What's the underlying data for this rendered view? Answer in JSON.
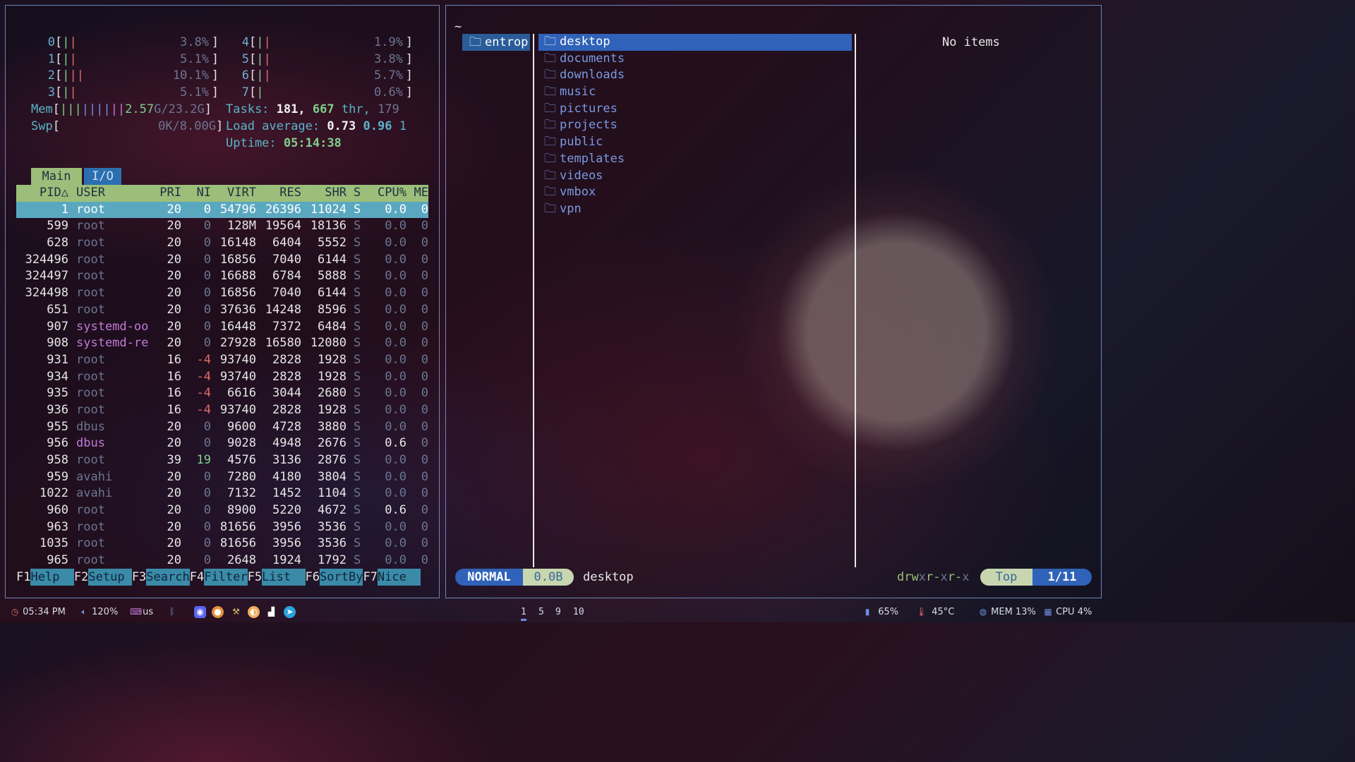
{
  "htop": {
    "cpus": [
      {
        "id": "0",
        "bars": "||",
        "pct": "3.8%"
      },
      {
        "id": "1",
        "bars": "||",
        "pct": "5.1%"
      },
      {
        "id": "2",
        "bars": "|||",
        "pct": "10.1%"
      },
      {
        "id": "3",
        "bars": "||",
        "pct": "5.1%"
      },
      {
        "id": "4",
        "bars": "||",
        "pct": "1.9%"
      },
      {
        "id": "5",
        "bars": "||",
        "pct": "3.8%"
      },
      {
        "id": "6",
        "bars": "||",
        "pct": "5.7%"
      },
      {
        "id": "7",
        "bars": "|",
        "pct": "0.6%"
      }
    ],
    "mem": {
      "label": "Mem",
      "bars": "|||||||||",
      "value": "2.57G/23.2G"
    },
    "swp": {
      "label": "Swp",
      "value": "0K/8.00G"
    },
    "tasks": {
      "label": "Tasks:",
      "count": "181,",
      "thr": "667",
      "thr_label": "thr,",
      "kthr": "179"
    },
    "load": {
      "label": "Load average:",
      "v1": "0.73",
      "v2": "0.96",
      "v3": "1"
    },
    "uptime": {
      "label": "Uptime:",
      "value": "05:14:38"
    },
    "tabs": {
      "main": "Main",
      "io": "I/O"
    },
    "columns": {
      "pid": "PID△",
      "user": "USER",
      "pri": "PRI",
      "ni": "NI",
      "virt": "VIRT",
      "res": "RES",
      "shr": "SHR",
      "s": "S",
      "cpu": "CPU%",
      "mem": "ME"
    },
    "rows": [
      {
        "pid": "1",
        "user": "root",
        "pri": "20",
        "ni": "0",
        "virt": "54796",
        "res": "26396",
        "shr": "11024",
        "s": "S",
        "cpu": "0.0",
        "mem": "0"
      },
      {
        "pid": "599",
        "user": "root",
        "pri": "20",
        "ni": "0",
        "virt": "128M",
        "res": "19564",
        "shr": "18136",
        "s": "S",
        "cpu": "0.0",
        "mem": "0"
      },
      {
        "pid": "628",
        "user": "root",
        "pri": "20",
        "ni": "0",
        "virt": "16148",
        "res": "6404",
        "shr": "5552",
        "s": "S",
        "cpu": "0.0",
        "mem": "0"
      },
      {
        "pid": "324496",
        "user": "root",
        "pri": "20",
        "ni": "0",
        "virt": "16856",
        "res": "7040",
        "shr": "6144",
        "s": "S",
        "cpu": "0.0",
        "mem": "0"
      },
      {
        "pid": "324497",
        "user": "root",
        "pri": "20",
        "ni": "0",
        "virt": "16688",
        "res": "6784",
        "shr": "5888",
        "s": "S",
        "cpu": "0.0",
        "mem": "0"
      },
      {
        "pid": "324498",
        "user": "root",
        "pri": "20",
        "ni": "0",
        "virt": "16856",
        "res": "7040",
        "shr": "6144",
        "s": "S",
        "cpu": "0.0",
        "mem": "0"
      },
      {
        "pid": "651",
        "user": "root",
        "pri": "20",
        "ni": "0",
        "virt": "37636",
        "res": "14248",
        "shr": "8596",
        "s": "S",
        "cpu": "0.0",
        "mem": "0"
      },
      {
        "pid": "907",
        "user": "systemd-oo",
        "pri": "20",
        "ni": "0",
        "virt": "16448",
        "res": "7372",
        "shr": "6484",
        "s": "S",
        "cpu": "0.0",
        "mem": "0"
      },
      {
        "pid": "908",
        "user": "systemd-re",
        "pri": "20",
        "ni": "0",
        "virt": "27928",
        "res": "16580",
        "shr": "12080",
        "s": "S",
        "cpu": "0.0",
        "mem": "0"
      },
      {
        "pid": "931",
        "user": "root",
        "pri": "16",
        "ni": "-4",
        "virt": "93740",
        "res": "2828",
        "shr": "1928",
        "s": "S",
        "cpu": "0.0",
        "mem": "0"
      },
      {
        "pid": "934",
        "user": "root",
        "pri": "16",
        "ni": "-4",
        "virt": "93740",
        "res": "2828",
        "shr": "1928",
        "s": "S",
        "cpu": "0.0",
        "mem": "0"
      },
      {
        "pid": "935",
        "user": "root",
        "pri": "16",
        "ni": "-4",
        "virt": "6616",
        "res": "3044",
        "shr": "2680",
        "s": "S",
        "cpu": "0.0",
        "mem": "0"
      },
      {
        "pid": "936",
        "user": "root",
        "pri": "16",
        "ni": "-4",
        "virt": "93740",
        "res": "2828",
        "shr": "1928",
        "s": "S",
        "cpu": "0.0",
        "mem": "0"
      },
      {
        "pid": "955",
        "user": "dbus",
        "pri": "20",
        "ni": "0",
        "virt": "9600",
        "res": "4728",
        "shr": "3880",
        "s": "S",
        "cpu": "0.0",
        "mem": "0"
      },
      {
        "pid": "956",
        "user": "dbus",
        "pri": "20",
        "ni": "0",
        "virt": "9028",
        "res": "4948",
        "shr": "2676",
        "s": "S",
        "cpu": "0.6",
        "mem": "0"
      },
      {
        "pid": "958",
        "user": "root",
        "pri": "39",
        "ni": "19",
        "virt": "4576",
        "res": "3136",
        "shr": "2876",
        "s": "S",
        "cpu": "0.0",
        "mem": "0"
      },
      {
        "pid": "959",
        "user": "avahi",
        "pri": "20",
        "ni": "0",
        "virt": "7280",
        "res": "4180",
        "shr": "3804",
        "s": "S",
        "cpu": "0.0",
        "mem": "0"
      },
      {
        "pid": "1022",
        "user": "avahi",
        "pri": "20",
        "ni": "0",
        "virt": "7132",
        "res": "1452",
        "shr": "1104",
        "s": "S",
        "cpu": "0.0",
        "mem": "0"
      },
      {
        "pid": "960",
        "user": "root",
        "pri": "20",
        "ni": "0",
        "virt": "8900",
        "res": "5220",
        "shr": "4672",
        "s": "S",
        "cpu": "0.6",
        "mem": "0"
      },
      {
        "pid": "963",
        "user": "root",
        "pri": "20",
        "ni": "0",
        "virt": "81656",
        "res": "3956",
        "shr": "3536",
        "s": "S",
        "cpu": "0.0",
        "mem": "0"
      },
      {
        "pid": "1035",
        "user": "root",
        "pri": "20",
        "ni": "0",
        "virt": "81656",
        "res": "3956",
        "shr": "3536",
        "s": "S",
        "cpu": "0.0",
        "mem": "0"
      },
      {
        "pid": "965",
        "user": "root",
        "pri": "20",
        "ni": "0",
        "virt": "2648",
        "res": "1924",
        "shr": "1792",
        "s": "S",
        "cpu": "0.0",
        "mem": "0"
      }
    ],
    "fkeys": [
      {
        "key": "F1",
        "label": "Help  "
      },
      {
        "key": "F2",
        "label": "Setup "
      },
      {
        "key": "F3",
        "label": "Search"
      },
      {
        "key": "F4",
        "label": "Filter"
      },
      {
        "key": "F5",
        "label": "List  "
      },
      {
        "key": "F6",
        "label": "SortBy"
      },
      {
        "key": "F7",
        "label": "Nice  "
      }
    ]
  },
  "files": {
    "path": "~",
    "parent": "entrop",
    "items": [
      "desktop",
      "documents",
      "downloads",
      "music",
      "pictures",
      "projects",
      "public",
      "templates",
      "videos",
      "vmbox",
      "vpn"
    ],
    "preview": "No items",
    "status": {
      "mode": "NORMAL",
      "size": "0.0B",
      "name": "desktop",
      "perm_a": "drw",
      "perm_b": "x",
      "perm_c": "r-",
      "perm_d": "x",
      "perm_e": "r-",
      "perm_f": "x",
      "pos": "Top",
      "count": "1/11"
    }
  },
  "bar": {
    "time": "05:34 PM",
    "volume": "120%",
    "layout": "us",
    "workspaces": [
      "1",
      "5",
      "9",
      "10"
    ],
    "battery": "65%",
    "temp": "45°C",
    "mem": "MEM 13%",
    "cpu": "CPU 4%"
  }
}
